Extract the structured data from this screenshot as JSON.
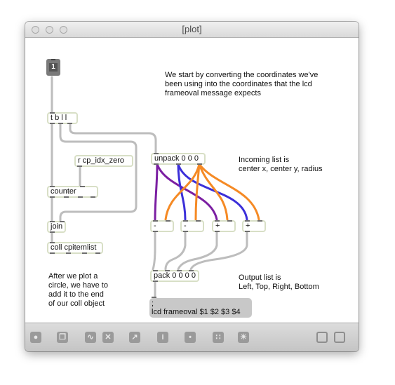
{
  "window": {
    "title": "[plot]"
  },
  "button": {
    "label": "1"
  },
  "objects": {
    "tbll": "t b l l",
    "receive": "r cp_idx_zero",
    "unpack": "unpack 0 0 0",
    "counter": "counter",
    "join": "join",
    "coll": "coll cpitemlist",
    "minus1": "-",
    "minus2": "-",
    "plus1": "+",
    "plus2": "+",
    "pack": "pack 0 0 0 0"
  },
  "message": {
    "line1": ";",
    "line2": "lcd frameoval $1 $2 $3 $4"
  },
  "comments": {
    "intro": "We start by converting the coordinates we've\nbeen using into the coordinates that the lcd\nframeoval message expects",
    "incoming": "Incoming list is\ncenter x,  center y, radius",
    "output": "Output list is\nLeft, Top, Right, Bottom",
    "after": "After we plot a\ncircle, we have to\nadd it to the end\nof our coll object"
  },
  "colors": {
    "purple": "#7b1fa2",
    "blue": "#3b2fd9",
    "orange": "#f58a25",
    "patchcord": "#bdbdbd"
  },
  "toolbar": [
    "lock-icon",
    "copy-icon",
    "patch-cord-icon",
    "close-icon",
    "graph-icon",
    "info-icon",
    "link-icon",
    "grid-icon",
    "palette-icon",
    "panel-icon",
    "window-icon"
  ]
}
